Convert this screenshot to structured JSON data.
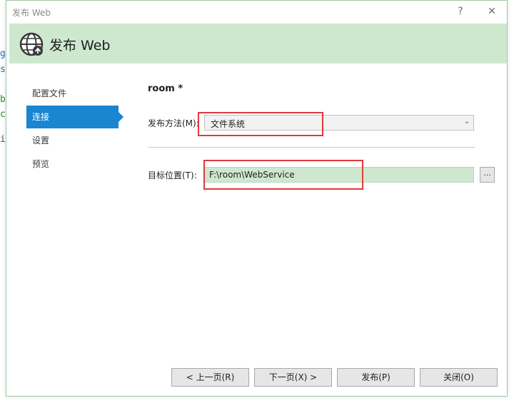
{
  "background": {
    "chars": [
      {
        "ch": "g",
        "color": "#1a6fb5"
      },
      {
        "ch": "s",
        "color": "#1a6fb5"
      },
      {
        "ch": "b",
        "color": "#2e8b3c"
      },
      {
        "ch": "c",
        "color": "#2e8b3c"
      },
      {
        "ch": "i",
        "color": "#555555"
      }
    ]
  },
  "window": {
    "title": "发布 Web",
    "help": "?",
    "close": "✕"
  },
  "header": {
    "title": "发布 Web",
    "icon": "globe-publish-icon"
  },
  "nav": {
    "items": [
      {
        "label": "配置文件",
        "active": false
      },
      {
        "label": "连接",
        "active": true
      },
      {
        "label": "设置",
        "active": false
      },
      {
        "label": "预览",
        "active": false
      }
    ]
  },
  "main": {
    "profile_name": "room *",
    "method_label": "发布方法(M):",
    "method_value": "文件系统",
    "target_label": "目标位置(T):",
    "target_value": "F:\\room\\WebService",
    "browse_label": "..."
  },
  "footer": {
    "prev_label": "< 上一页(R)",
    "next_label": "下一页(X) >",
    "publish_label": "发布(P)",
    "close_label": "关闭(O)"
  },
  "colors": {
    "accent": "#1a85d0",
    "header_bg": "#cde8cf",
    "highlight": "#e0393e"
  }
}
